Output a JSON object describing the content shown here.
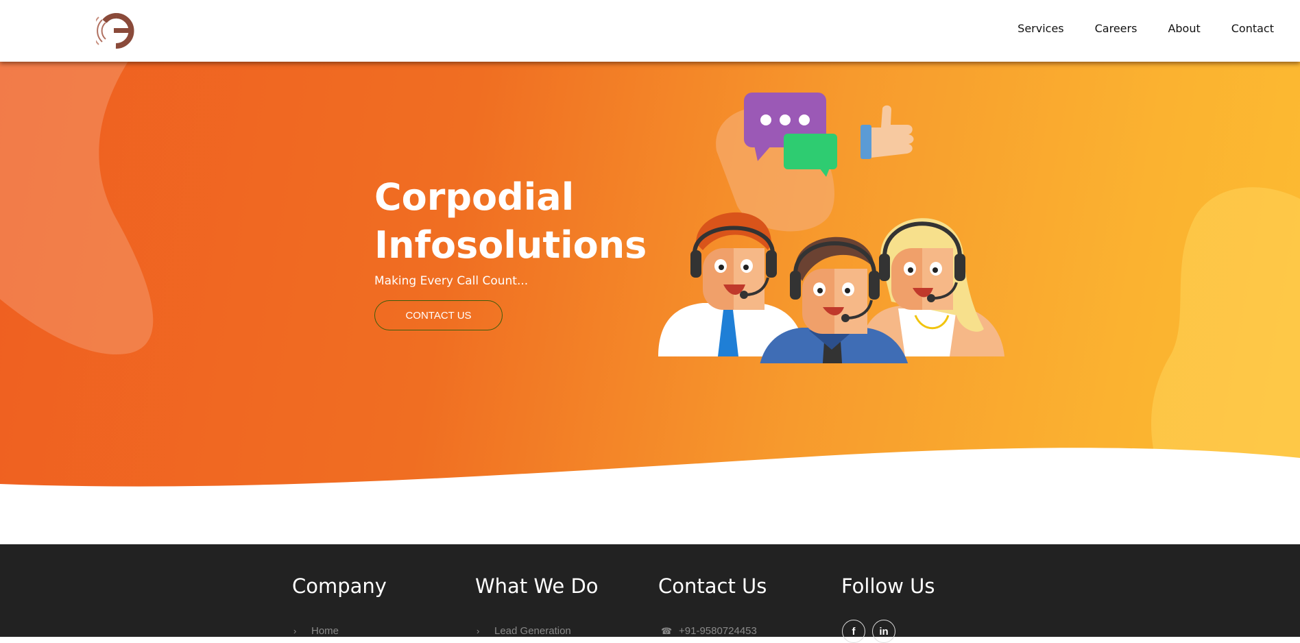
{
  "header": {
    "logo_icon": "corpodial-logo-icon",
    "nav": [
      {
        "label": "Services"
      },
      {
        "label": "Careers"
      },
      {
        "label": "About"
      },
      {
        "label": "Contact"
      }
    ]
  },
  "hero": {
    "title_line1": "Corpodial",
    "title_line2": "Infosolutions",
    "tagline": "Making Every Call Count...",
    "cta_label": "CONTACT US",
    "illustration_icon": "call-center-agents-illustration"
  },
  "footer": {
    "company": {
      "heading": "Company",
      "first_link": "Home"
    },
    "what_we_do": {
      "heading": "What We Do",
      "first_link": "Lead Generation"
    },
    "contact": {
      "heading": "Contact Us",
      "phone": "+91-9580724453"
    },
    "follow": {
      "heading": "Follow Us",
      "social": [
        "f",
        "in"
      ]
    }
  },
  "colors": {
    "hero_orange": "#ef5f21",
    "hero_yellow": "#fcbc32",
    "footer_bg": "#222222",
    "logo_brown": "#8a4a3a"
  }
}
